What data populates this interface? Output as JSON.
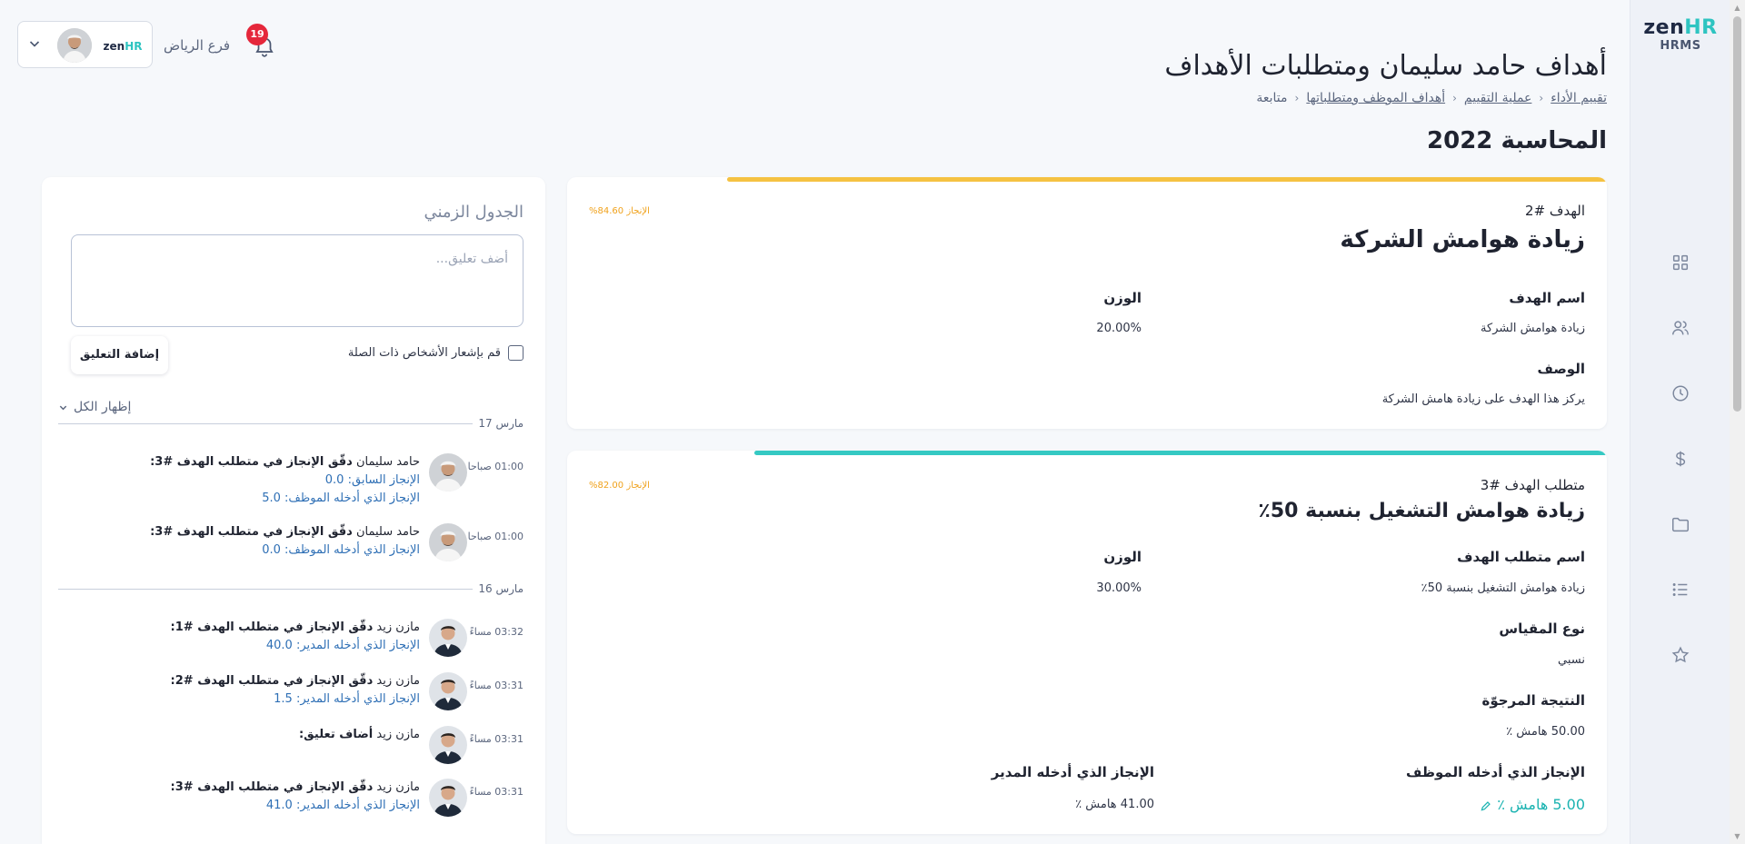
{
  "header": {
    "title": "أهداف حامد سليمان ومتطلبات الأهداف",
    "breadcrumb": [
      "تقييم الأداء",
      "عملية التقييم",
      "أهداف الموظف ومتطلباتها",
      "متابعة"
    ],
    "cycle": "المحاسبة 2022"
  },
  "topbar": {
    "branch": "فرع الرياض",
    "notifications": "19",
    "brand_zen": "zen",
    "brand_hr": "HR"
  },
  "sidebar": {
    "logo_zen": "zen",
    "logo_hr": "HR",
    "logo_sub": "HRMS",
    "icons": [
      "grid-icon",
      "users-icon",
      "clock-icon",
      "dollar-icon",
      "folder-icon",
      "list-icon",
      "star-icon"
    ]
  },
  "goal": {
    "number": "الهدف #2",
    "title": "زيادة هوامش الشركة",
    "achievement": "الإنجاز 84.60%",
    "achievement_value": 0.846,
    "name_label": "اسم الهدف",
    "name_value": "زيادة هوامش الشركة",
    "weight_label": "الوزن",
    "weight_value": "20.00%",
    "desc_label": "الوصف",
    "desc_value": "يركز هذا الهدف على زيادة هامش الشركة",
    "color": "#f5c242"
  },
  "requirement": {
    "number": "متطلب الهدف #3",
    "title": "زيادة هوامش التشغيل بنسبة 50٪",
    "achievement": "الإنجاز 82.00%",
    "achievement_value": 0.82,
    "name_label": "اسم متطلب الهدف",
    "name_value": "زيادة هوامش التشغيل بنسبة 50٪",
    "weight_label": "الوزن",
    "weight_value": "30.00%",
    "measure_label": "نوع المقياس",
    "measure_value": "نسبي",
    "target_label": "النتيجة المرجوّة",
    "target_value": "50.00 هامش ٪",
    "emp_label": "الإنجاز الذي أدخله الموظف",
    "emp_value": "5.00 هامش ٪",
    "mgr_label": "الإنجاز الذي أدخله المدير",
    "mgr_value": "41.00 هامش ٪",
    "color": "#35c9c3"
  },
  "timeline": {
    "title": "الجدول الزمني",
    "comment_placeholder": "أضف تعليق...",
    "notify_label": "قم بإشعار الأشخاص ذات الصلة",
    "add_button": "إضافة التعليق",
    "show_all": "إظهار الكل",
    "dates": [
      "مارس 17",
      "مارس 16"
    ],
    "entries": [
      {
        "time": "01:00 صباحا",
        "name": "حامد سليمان",
        "action": "دقّق الإنجاز في متطلب الهدف #3:",
        "line1_label": "الإنجاز السابق:",
        "line1_value": "0.0",
        "line2_label": "الإنجاز الذي أدخله الموظف:",
        "line2_value": "5.0"
      },
      {
        "time": "01:00 صباحا",
        "name": "حامد سليمان",
        "action": "دقّق الإنجاز في متطلب الهدف #3:",
        "line1_label": "الإنجاز الذي أدخله الموظف:",
        "line1_value": "0.0"
      },
      {
        "time": "03:32 مساءً",
        "name": "مازن زيد",
        "action": "دقّق الإنجاز في متطلب الهدف #1:",
        "line1_label": "الإنجاز الذي أدخله المدير:",
        "line1_value": "40.0"
      },
      {
        "time": "03:31 مساءً",
        "name": "مازن زيد",
        "action": "دقّق الإنجاز في متطلب الهدف #2:",
        "line1_label": "الإنجاز الذي أدخله المدير:",
        "line1_value": "1.5"
      },
      {
        "time": "03:31 مساءً",
        "name": "مازن زيد",
        "action": "أضاف تعليق:"
      },
      {
        "time": "03:31 مساءً",
        "name": "مازن زيد",
        "action": "دقّق الإنجاز في متطلب الهدف #3:",
        "line1_label": "الإنجاز الذي أدخله المدير:",
        "line1_value": "41.0"
      }
    ]
  }
}
